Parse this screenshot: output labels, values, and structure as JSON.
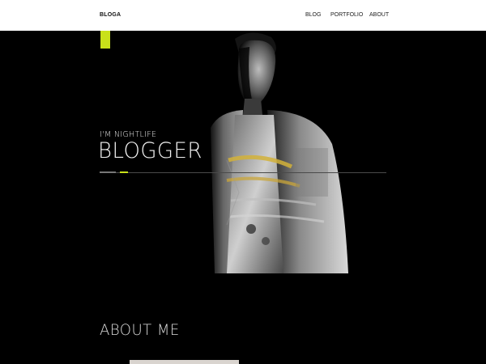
{
  "header": {
    "logo": "BLOGA",
    "nav": [
      {
        "label": "BLOG"
      },
      {
        "label": "PORTFOLIO"
      },
      {
        "label": "ABOUT"
      }
    ]
  },
  "hero": {
    "kicker": "I'M NIGHTLIFE",
    "headline": "BLOGGER",
    "photo_icon": "portrait-photo",
    "accent_color": "#c9e11a"
  },
  "about": {
    "title": "ABOUT ME"
  }
}
